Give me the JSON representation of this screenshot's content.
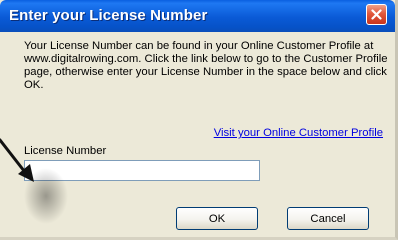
{
  "window": {
    "title": "Enter your License Number",
    "close_icon": "close-x-icon"
  },
  "content": {
    "description": "Your License Number can be found in your Online Customer Profile at www.digitalrowing.com.  Click the link below to go to the Customer Profile page, otherwise enter your License Number in the space below and click OK.",
    "link_text": "Visit your Online Customer Profile",
    "license_label": "License Number",
    "license_value": "",
    "license_placeholder": ""
  },
  "buttons": {
    "ok_label": "OK",
    "cancel_label": "Cancel"
  },
  "colors": {
    "titlebar": "#0a5ad6",
    "dialog_bg": "#ece9d8",
    "link": "#0000e0",
    "close_button": "#e2583c"
  },
  "annotation": {
    "icon": "pointer-arrow-icon"
  }
}
